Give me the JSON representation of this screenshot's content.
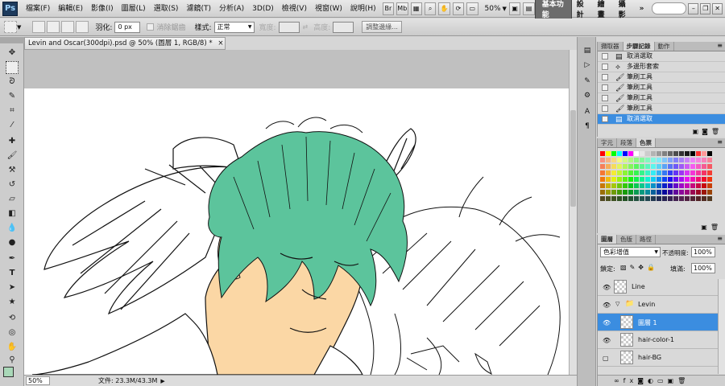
{
  "app": {
    "logo": "Ps"
  },
  "menubar": {
    "items": [
      "檔案(F)",
      "編輯(E)",
      "影像(I)",
      "圖層(L)",
      "選取(S)",
      "濾鏡(T)",
      "分析(A)",
      "3D(D)",
      "檢視(V)",
      "視窗(W)",
      "說明(H)"
    ],
    "zoom": "50%",
    "workspaces": [
      "基本功能",
      "設計",
      "繪畫",
      "攝影"
    ],
    "more": "»"
  },
  "options": {
    "feather_label": "羽化:",
    "feather_value": "0 px",
    "antialias_label": "消除鋸齒",
    "style_label": "樣式:",
    "style_value": "正常",
    "width_label": "寬度:",
    "height_label": "高度:",
    "refine_edge": "調整邊緣..."
  },
  "document": {
    "tab_title": "Levin and Oscar(300dpi).psd @ 50% (圖層 1, RGB/8) *",
    "zoom": "50%",
    "doc_size": "文件: 23.3M/43.3M"
  },
  "history_panel": {
    "tabs": [
      "擷取器",
      "步驟記錄",
      "動作"
    ],
    "active_tab": 1,
    "items": [
      {
        "label": "取消選取",
        "icon": "selection-icon"
      },
      {
        "label": "多邊形套索",
        "icon": "lasso-icon"
      },
      {
        "label": "筆刷工具",
        "icon": "brush-icon"
      },
      {
        "label": "筆刷工具",
        "icon": "brush-icon"
      },
      {
        "label": "筆刷工具",
        "icon": "brush-icon"
      },
      {
        "label": "筆刷工具",
        "icon": "brush-icon"
      },
      {
        "label": "取消選取",
        "icon": "selection-icon"
      }
    ],
    "active_index": 6
  },
  "swatches_panel": {
    "tabs": [
      "字元",
      "段落",
      "色票"
    ],
    "active_tab": 2
  },
  "layers_panel": {
    "tabs": [
      "圖層",
      "色版",
      "路徑"
    ],
    "active_tab": 0,
    "blend_mode": "色彩增值",
    "opacity_label": "不透明度:",
    "opacity_value": "100%",
    "lock_label": "鎖定:",
    "fill_label": "填滿:",
    "fill_value": "100%",
    "layers": [
      {
        "name": "Line",
        "visible": true,
        "type": "layer"
      },
      {
        "name": "Levin",
        "visible": true,
        "type": "group"
      },
      {
        "name": "圖層 1",
        "visible": true,
        "type": "layer",
        "active": true
      },
      {
        "name": "hair-color-1",
        "visible": true,
        "type": "layer"
      },
      {
        "name": "hair-BG",
        "visible": false,
        "type": "layer"
      }
    ]
  },
  "colors": {
    "foreground": "#a9d8b8",
    "background": "#ffffff",
    "hair": "#5cc49c",
    "skin": "#fbd7a5",
    "selection": "#3b8de0"
  }
}
